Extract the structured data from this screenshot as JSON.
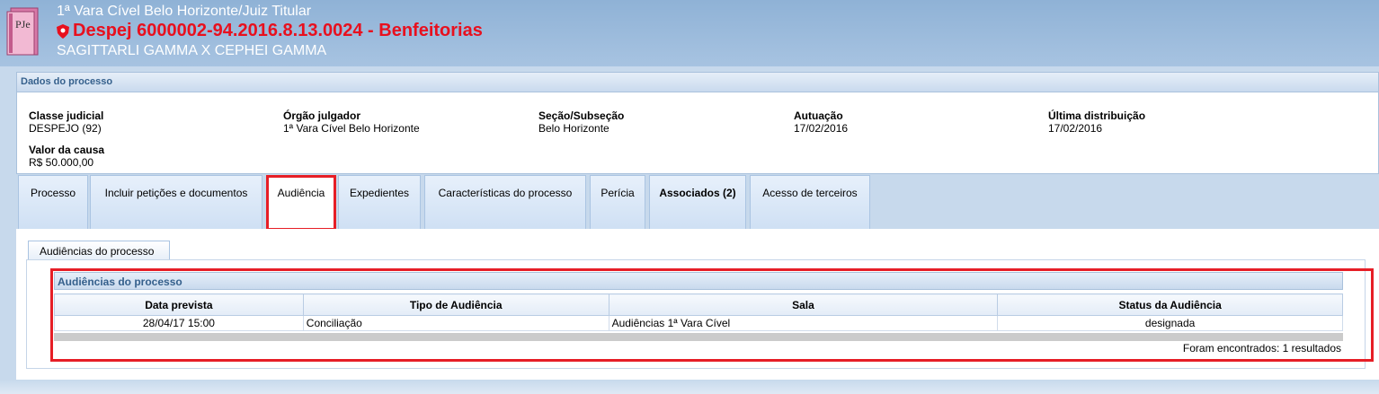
{
  "header": {
    "orgao_juiz": "1ª Vara Cível Belo Horizonte/Juiz Titular",
    "process_title": "Despej 6000002-94.2016.8.13.0024 - Benfeitorias",
    "parties": "SAGITTARLI GAMMA X CEPHEI GAMMA",
    "logo_text": "PJe"
  },
  "dados": {
    "title": "Dados do processo",
    "fields": [
      {
        "label": "Classe judicial",
        "value": "DESPEJO (92)"
      },
      {
        "label": "Órgão julgador",
        "value": "1ª Vara Cível Belo Horizonte"
      },
      {
        "label": "Seção/Subseção",
        "value": "Belo Horizonte"
      },
      {
        "label": "Autuação",
        "value": "17/02/2016"
      },
      {
        "label": "Última distribuição",
        "value": "17/02/2016"
      },
      {
        "label": "Valor da causa",
        "value": "R$ 50.000,00"
      }
    ]
  },
  "tabs": [
    {
      "label": "Processo"
    },
    {
      "label": "Incluir petições e documentos"
    },
    {
      "label": "Audiência",
      "active": true
    },
    {
      "label": "Expedientes"
    },
    {
      "label": "Características do processo"
    },
    {
      "label": "Perícia"
    },
    {
      "label": "Associados (2)",
      "bold": true
    },
    {
      "label": "Acesso de terceiros"
    }
  ],
  "audiencias": {
    "subtab": "Audiências do processo",
    "panel_title": "Audiências do processo",
    "columns": [
      "Data prevista",
      "Tipo de Audiência",
      "Sala",
      "Status da Audiência"
    ],
    "rows": [
      [
        "28/04/17 15:00",
        "Conciliação",
        "Audiências 1ª Vara Cível",
        "designada"
      ]
    ],
    "result_text": "Foram encontrados: 1 resultados"
  },
  "colors": {
    "header_bg": "#a7c3e1",
    "title_red": "#e8101e",
    "highlight_red": "#e61e26",
    "panel_head_text": "#35608c"
  }
}
